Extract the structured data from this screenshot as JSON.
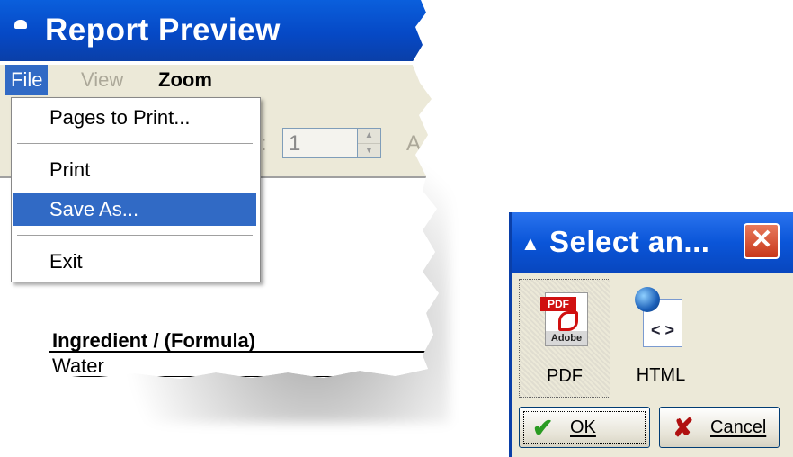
{
  "report_window": {
    "title": "Report Preview",
    "menu": [
      {
        "label": "File",
        "state": "active"
      },
      {
        "label": "View",
        "state": "disabled"
      },
      {
        "label": "Zoom",
        "state": "normal"
      }
    ],
    "toolbar": {
      "page_value": "1",
      "partial_label_right": "A",
      "partial_label_left": ":"
    },
    "file_menu": {
      "items": [
        {
          "label": "Pages to Print..."
        },
        {
          "label": "Print"
        },
        {
          "label": "Save As...",
          "selected": true
        },
        {
          "label": "Exit"
        }
      ]
    },
    "report": {
      "column_header": "Ingredient / (Formula)",
      "rows": [
        "Water"
      ]
    }
  },
  "dialog": {
    "title": "Select an...",
    "options": [
      {
        "label": "PDF",
        "icon": "pdf-file-icon",
        "badge": "PDF",
        "brand": "Adobe",
        "selected": true
      },
      {
        "label": "HTML",
        "icon": "html-file-icon",
        "glyph": "< >"
      }
    ],
    "ok_label": "OK",
    "cancel_label": "Cancel"
  },
  "colors": {
    "titlebar_blue": "#0a5fdc",
    "selection_blue": "#316ac5",
    "dialog_face": "#ece9d8",
    "close_red": "#c8381a"
  }
}
